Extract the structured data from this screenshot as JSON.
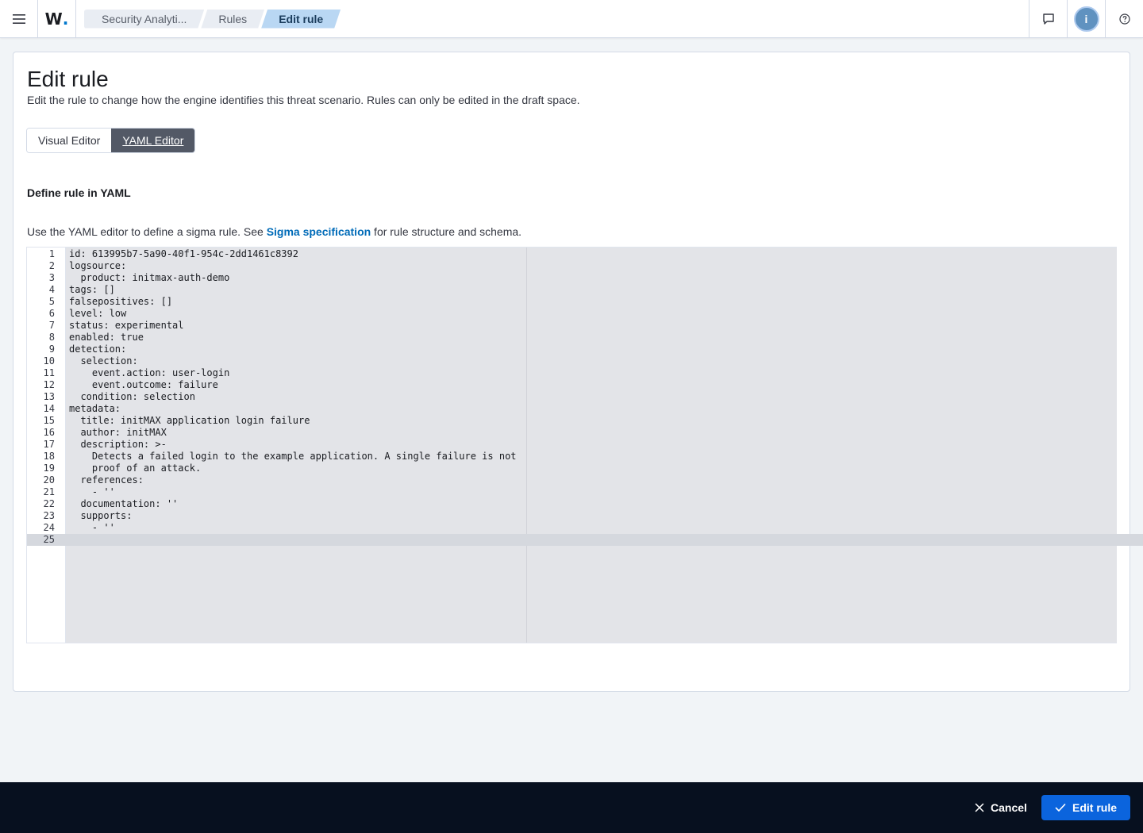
{
  "header": {
    "menu_icon": "hamburger-menu-icon",
    "logo": {
      "letter": "W",
      "dot": "."
    },
    "breadcrumbs": [
      "Security Analyti...",
      "Rules",
      "Edit rule"
    ],
    "avatar_initial": "i",
    "icons": [
      "chat-icon",
      "user-avatar",
      "help-icon"
    ]
  },
  "page": {
    "title": "Edit rule",
    "description": "Edit the rule to change how the engine identifies this threat scenario. Rules can only be edited in the draft space.",
    "tabs": [
      "Visual Editor",
      "YAML Editor"
    ],
    "active_tab": "YAML Editor",
    "section_title": "Define rule in YAML",
    "help": {
      "before": "Use the YAML editor to define a sigma rule. See ",
      "link": "Sigma specification",
      "after": " for rule structure and schema."
    }
  },
  "editor": {
    "active_line": 25,
    "lines": [
      "id: 613995b7-5a90-40f1-954c-2dd1461c8392",
      "logsource:",
      "  product: initmax-auth-demo",
      "tags: []",
      "falsepositives: []",
      "level: low",
      "status: experimental",
      "enabled: true",
      "detection:",
      "  selection:",
      "    event.action: user-login",
      "    event.outcome: failure",
      "  condition: selection",
      "metadata:",
      "  title: initMAX application login failure",
      "  author: initMAX",
      "  description: >-",
      "    Detects a failed login to the example application. A single failure is not",
      "    proof of an attack.",
      "  references:",
      "    - ''",
      "  documentation: ''",
      "  supports:",
      "    - ''",
      ""
    ]
  },
  "footer": {
    "cancel_label": "Cancel",
    "submit_label": "Edit rule"
  },
  "colors": {
    "primary": "#0b64dd",
    "footer_bg": "#07101f",
    "active_tab": "#535966",
    "link": "#006bb8",
    "breadcrumb_current": "#b9d7f3"
  }
}
